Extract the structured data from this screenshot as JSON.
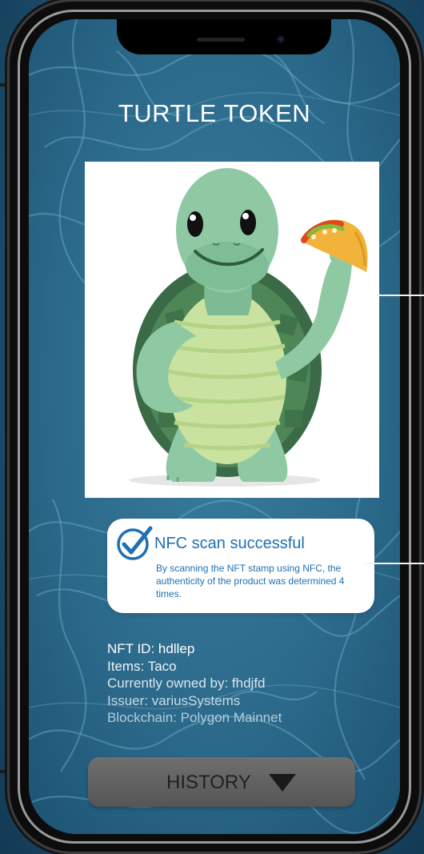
{
  "app": {
    "title": "TURTLE TOKEN"
  },
  "nft_image": {
    "description_icon": "turtle-with-taco-illustration"
  },
  "scan_status": {
    "title": "NFC scan successful",
    "description": "By scanning the NFT stamp using NFC, the authenticity of the product was determined 4 times.",
    "icon": "checkmark-circle-icon",
    "color": "#1e6fb3"
  },
  "nft_info": {
    "nft_id": "NFT ID: hdllep",
    "items": "Items: Taco",
    "owner": "Currently owned by: fhdjfd",
    "issuer": "Issuer: variusSystems",
    "blockchain": "Blockchain: Polygon Mainnet"
  },
  "history_button": {
    "label": "HISTORY",
    "icon": "triangle-down-icon"
  },
  "colors": {
    "background": "#1d4e6c",
    "screen": "#2f6d8e",
    "accent": "#1e6fb3",
    "button": "#5f5f5f"
  }
}
